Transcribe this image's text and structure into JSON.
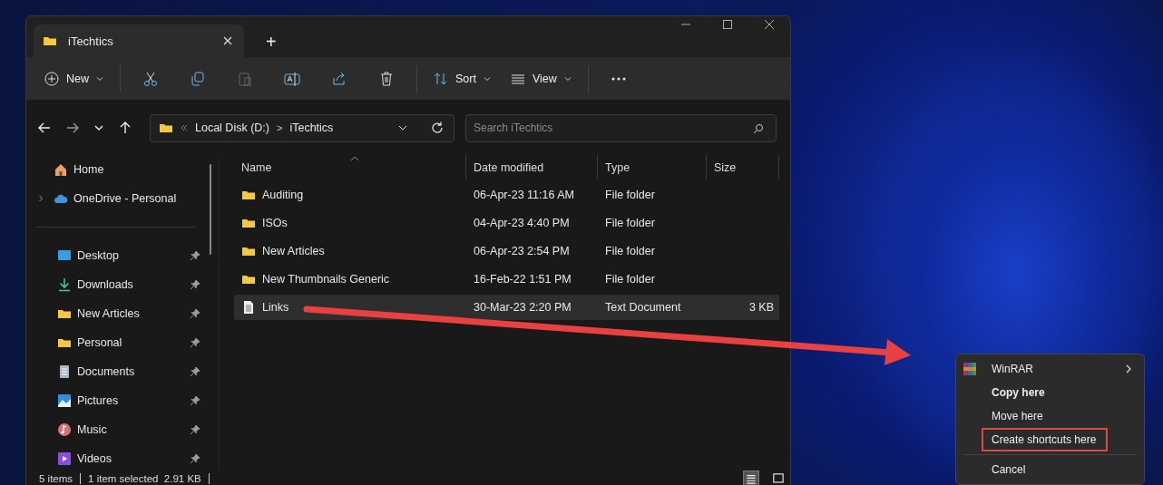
{
  "window": {
    "tab_title": "iTechtics",
    "new_tab": "+"
  },
  "toolbar": {
    "new": "New",
    "sort": "Sort",
    "view": "View"
  },
  "address": {
    "breadcrumbs": [
      "Local Disk (D:)",
      "iTechtics"
    ],
    "separator": ">",
    "search_placeholder": "Search iTechtics"
  },
  "sidebar": {
    "top_items": [
      {
        "label": "Home",
        "kind": "home",
        "expandable": false
      },
      {
        "label": "OneDrive - Personal",
        "kind": "cloud",
        "expandable": true
      }
    ],
    "items": [
      {
        "label": "Desktop",
        "kind": "desktop",
        "pinned": true
      },
      {
        "label": "Downloads",
        "kind": "download",
        "pinned": true
      },
      {
        "label": "New Articles",
        "kind": "folder",
        "pinned": true
      },
      {
        "label": "Personal",
        "kind": "folder",
        "pinned": true
      },
      {
        "label": "Documents",
        "kind": "documents",
        "pinned": true
      },
      {
        "label": "Pictures",
        "kind": "pictures",
        "pinned": true
      },
      {
        "label": "Music",
        "kind": "music",
        "pinned": true
      },
      {
        "label": "Videos",
        "kind": "videos",
        "pinned": true
      }
    ]
  },
  "table": {
    "columns": [
      {
        "label": "Name",
        "sorted": true
      },
      {
        "label": "Date modified",
        "sorted": false
      },
      {
        "label": "Type",
        "sorted": false
      },
      {
        "label": "Size",
        "sorted": false
      }
    ],
    "rows": [
      {
        "name": "Auditing",
        "date": "06-Apr-23 11:16 AM",
        "type": "File folder",
        "size": "",
        "kind": "folder",
        "selected": false
      },
      {
        "name": "ISOs",
        "date": "04-Apr-23 4:40 PM",
        "type": "File folder",
        "size": "",
        "kind": "folder",
        "selected": false
      },
      {
        "name": "New Articles",
        "date": "06-Apr-23 2:54 PM",
        "type": "File folder",
        "size": "",
        "kind": "folder",
        "selected": false
      },
      {
        "name": "New Thumbnails Generic",
        "date": "16-Feb-22 1:51 PM",
        "type": "File folder",
        "size": "",
        "kind": "folder",
        "selected": false
      },
      {
        "name": "Links",
        "date": "30-Mar-23 2:20 PM",
        "type": "Text Document",
        "size": "3 KB",
        "kind": "text",
        "selected": true
      }
    ]
  },
  "status_bar": {
    "count": "5 items",
    "selection": "1 item selected  2.91 KB",
    "views": [
      {
        "kind": "details",
        "selected": true
      },
      {
        "kind": "tiles",
        "selected": false
      }
    ]
  },
  "context_menu": {
    "items": [
      {
        "kind": "submenu",
        "label": "WinRAR",
        "bold": false,
        "highlighted": false
      },
      {
        "kind": "item",
        "label": "Copy here",
        "bold": true,
        "highlighted": false
      },
      {
        "kind": "item",
        "label": "Move here",
        "bold": false,
        "highlighted": false
      },
      {
        "kind": "item",
        "label": "Create shortcuts here",
        "bold": false,
        "highlighted": true
      },
      {
        "kind": "separator"
      },
      {
        "kind": "item",
        "label": "Cancel",
        "bold": false,
        "highlighted": false
      }
    ]
  }
}
